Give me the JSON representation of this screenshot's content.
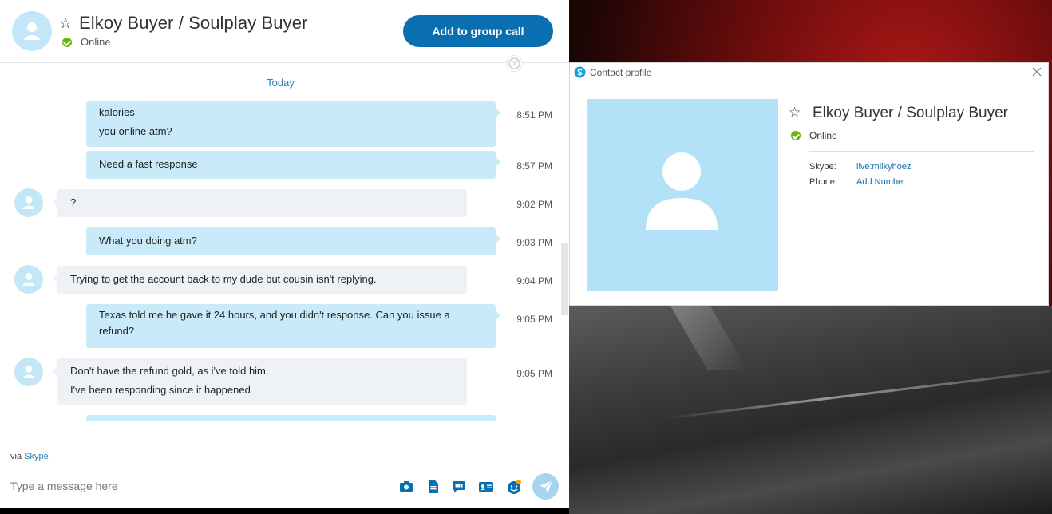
{
  "contact": {
    "name": "Elkoy Buyer / Soulplay Buyer",
    "status": "Online"
  },
  "header": {
    "group_call_label": "Add to group call"
  },
  "conversation": {
    "day_label": "Today",
    "messages": [
      {
        "direction": "out",
        "lines": [
          "kalories",
          "you online atm?"
        ],
        "time": "8:51 PM"
      },
      {
        "direction": "out",
        "lines": [
          "Need a fast response"
        ],
        "time": "8:57 PM"
      },
      {
        "direction": "in",
        "lines": [
          "?"
        ],
        "time": "9:02 PM"
      },
      {
        "direction": "out",
        "lines": [
          "What you doing atm?"
        ],
        "time": "9:03 PM"
      },
      {
        "direction": "in",
        "lines": [
          "Trying to get the account back to my dude but cousin isn't replying."
        ],
        "time": "9:04 PM"
      },
      {
        "direction": "out",
        "lines": [
          "Texas told me he gave it 24 hours, and you didn't response. Can you issue a",
          "refund?"
        ],
        "time": "9:05 PM"
      },
      {
        "direction": "in",
        "lines": [
          "Don't have the refund gold, as i've told him.",
          "I've been responding since it happened"
        ],
        "time": "9:05 PM"
      }
    ]
  },
  "footer": {
    "via_prefix": "via",
    "via_link": "Skype",
    "compose_placeholder": "Type a message here"
  },
  "toolbar_icons": [
    "media-icon",
    "file-icon",
    "video-message-icon",
    "contact-card-icon",
    "emoticon-icon",
    "send-icon"
  ],
  "profile_window": {
    "title": "Contact profile",
    "fields": [
      {
        "key": "Skype:",
        "value": "live:milkyhoez"
      },
      {
        "key": "Phone:",
        "value": "Add Number"
      }
    ]
  },
  "colors": {
    "accent": "#0a6fb0",
    "outgoing_bubble": "#c8eaf9",
    "incoming_bubble": "#eef1f5",
    "online": "#6bb700",
    "avatar": "#c4e7f7"
  }
}
